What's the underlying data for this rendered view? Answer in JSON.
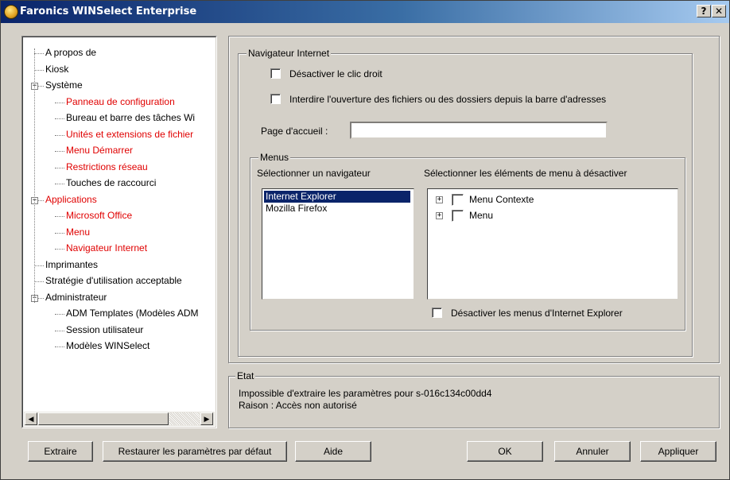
{
  "window": {
    "title": "Faronics WINSelect Enterprise",
    "help_label": "?",
    "close_label": "✕"
  },
  "tree": {
    "items": [
      {
        "label": "A propos de",
        "red": false
      },
      {
        "label": "Kiosk",
        "red": false
      },
      {
        "label": "Système",
        "red": false,
        "expander": "−"
      },
      {
        "label": "Panneau de configuration",
        "red": true
      },
      {
        "label": "Bureau et barre des tâches Wi",
        "red": false
      },
      {
        "label": "Unités et extensions de fichier",
        "red": true
      },
      {
        "label": "Menu Démarrer",
        "red": true
      },
      {
        "label": "Restrictions réseau",
        "red": true
      },
      {
        "label": "Touches de raccourci",
        "red": false
      },
      {
        "label": "Applications",
        "red": true,
        "expander": "−"
      },
      {
        "label": "Microsoft Office",
        "red": true
      },
      {
        "label": "Menu",
        "red": true
      },
      {
        "label": "Navigateur Internet",
        "red": true
      },
      {
        "label": "Imprimantes",
        "red": false
      },
      {
        "label": "Stratégie d'utilisation acceptable",
        "red": false
      },
      {
        "label": "Administrateur",
        "red": false,
        "expander": "−"
      },
      {
        "label": "ADM Templates (Modèles ADM",
        "red": false
      },
      {
        "label": "Session utilisateur",
        "red": false
      },
      {
        "label": "Modèles WINSelect",
        "red": false
      }
    ],
    "scroll_left": "◀",
    "scroll_right": "▶"
  },
  "browser_group": {
    "title": "Navigateur Internet",
    "disable_right_click": "Désactiver le clic droit",
    "block_address_bar": "Interdire l'ouverture des fichiers ou des dossiers depuis la barre d'adresses",
    "home_page_label": "Page d'accueil :",
    "home_page_value": ""
  },
  "menus_group": {
    "title": "Menus",
    "select_browser_label": "Sélectionner un navigateur",
    "select_items_label": "Sélectionner les éléments de menu à désactiver",
    "browsers": [
      "Internet Explorer",
      "Mozilla Firefox"
    ],
    "selected_browser": "Internet Explorer",
    "menu_items": [
      {
        "label": "Menu Contexte",
        "expander": "+"
      },
      {
        "label": "Menu",
        "expander": "+"
      }
    ],
    "disable_ie_menus": "Désactiver les menus d'Internet Explorer"
  },
  "status_group": {
    "title": "Etat",
    "line1": "Impossible d'extraire les paramètres pour s-016c134c00dd4",
    "line2": "Raison : Accès non autorisé"
  },
  "buttons": {
    "extract": "Extraire",
    "restore": "Restaurer les paramètres par défaut",
    "help": "Aide",
    "ok": "OK",
    "cancel": "Annuler",
    "apply": "Appliquer"
  }
}
